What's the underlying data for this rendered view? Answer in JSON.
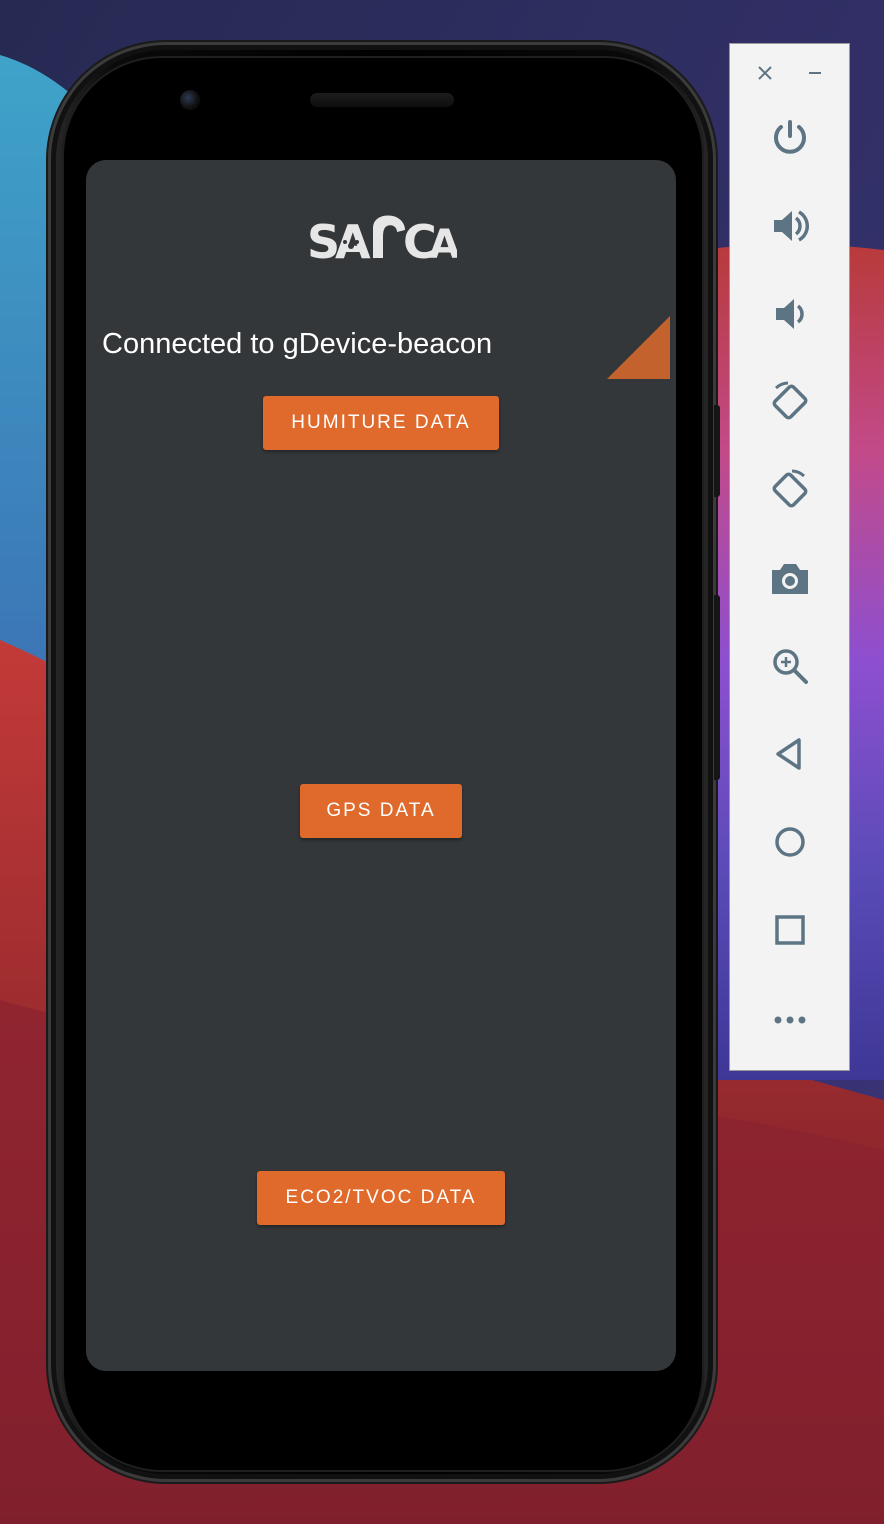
{
  "app": {
    "logo_text": "SACA",
    "status_text": "Connected to gDevice-beacon",
    "buttons": {
      "humiture": "HUMITURE DATA",
      "gps": "GPS DATA",
      "eco2_tvoc": "ECO2/TVOC DATA"
    }
  },
  "colors": {
    "screen_bg": "#343739",
    "accent": "#e06a2c",
    "triangle": "#c4622e",
    "toolbar_icon": "#5c7483",
    "toolbar_bg": "#f3f3f3"
  },
  "toolbar": {
    "items": [
      {
        "name": "power-icon"
      },
      {
        "name": "volume-up-icon"
      },
      {
        "name": "volume-down-icon"
      },
      {
        "name": "rotate-left-icon"
      },
      {
        "name": "rotate-right-icon"
      },
      {
        "name": "camera-icon"
      },
      {
        "name": "zoom-icon"
      },
      {
        "name": "back-icon"
      },
      {
        "name": "home-icon"
      },
      {
        "name": "overview-icon"
      },
      {
        "name": "more-icon"
      }
    ]
  }
}
